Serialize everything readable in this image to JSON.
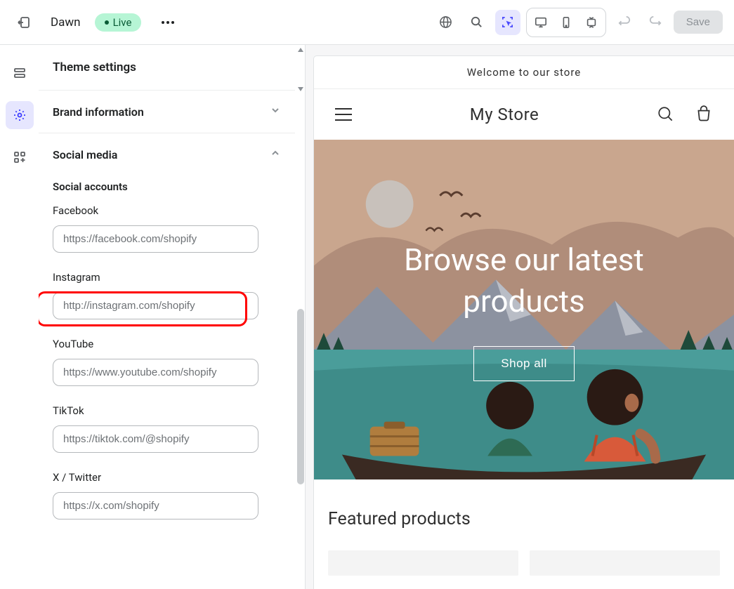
{
  "topbar": {
    "theme_name": "Dawn",
    "status_badge": "Live",
    "save_label": "Save"
  },
  "sidebar": {
    "title": "Theme settings",
    "brand_section": "Brand information",
    "social_section": "Social media",
    "social_subtitle": "Social accounts",
    "fields": {
      "facebook": {
        "label": "Facebook",
        "value": "https://facebook.com/shopify"
      },
      "instagram": {
        "label": "Instagram",
        "value": "http://instagram.com/shopify"
      },
      "youtube": {
        "label": "YouTube",
        "value": "https://www.youtube.com/shopify"
      },
      "tiktok": {
        "label": "TikTok",
        "value": "https://tiktok.com/@shopify"
      },
      "twitter": {
        "label": "X / Twitter",
        "value": "https://x.com/shopify"
      }
    }
  },
  "preview": {
    "announcement": "Welcome to our store",
    "store_name": "My Store",
    "hero_title": "Browse our latest products",
    "shop_button": "Shop all",
    "featured_title": "Featured products"
  }
}
